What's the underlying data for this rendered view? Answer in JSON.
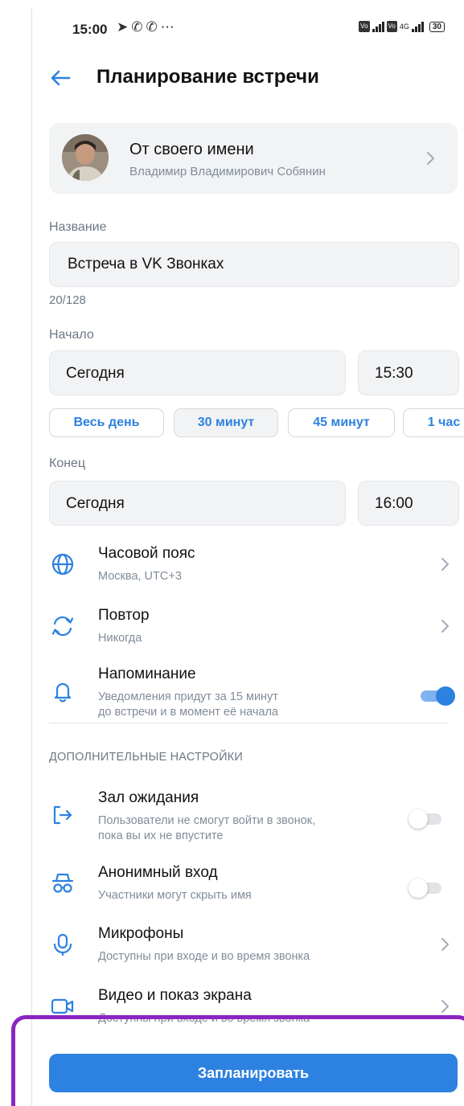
{
  "status_bar": {
    "time": "15:00",
    "left_icons": [
      "location-arrow-icon",
      "whatsapp-icon",
      "viber-icon",
      "more-dots-icon"
    ],
    "network_label": "4G",
    "battery": "30"
  },
  "header": {
    "title": "Планирование встречи"
  },
  "author": {
    "title": "От своего имени",
    "name": "Владимир Владимирович Собянин"
  },
  "name_field": {
    "label": "Название",
    "value": "Встреча в VK Звонках",
    "counter": "20/128"
  },
  "start": {
    "label": "Начало",
    "date": "Сегодня",
    "time": "15:30"
  },
  "duration_chips": [
    {
      "label": "Весь день",
      "selected": false
    },
    {
      "label": "30 минут",
      "selected": true
    },
    {
      "label": "45 минут",
      "selected": false
    },
    {
      "label": "1 час",
      "selected": false
    }
  ],
  "end": {
    "label": "Конец",
    "date": "Сегодня",
    "time": "16:00"
  },
  "settings": {
    "timezone": {
      "title": "Часовой пояс",
      "subtitle": "Москва, UTC+3"
    },
    "repeat": {
      "title": "Повтор",
      "subtitle": "Никогда"
    },
    "reminder": {
      "title": "Напоминание",
      "subtitle_line1": "Уведомления придут за 15 минут",
      "subtitle_line2": "до встречи и в момент её начала",
      "enabled": true
    }
  },
  "additional": {
    "header": "ДОПОЛНИТЕЛЬНЫЕ НАСТРОЙКИ",
    "waiting_room": {
      "title": "Зал ожидания",
      "subtitle_line1": "Пользователи не смогут войти в звонок,",
      "subtitle_line2": "пока вы их не впустите",
      "enabled": false
    },
    "anonymous": {
      "title": "Анонимный вход",
      "subtitle": "Участники могут скрыть имя",
      "enabled": false
    },
    "microphones": {
      "title": "Микрофоны",
      "subtitle": "Доступны при входе и во время звонка"
    },
    "video": {
      "title": "Видео и показ экрана",
      "subtitle": "Доступны при входе и во время звонка"
    }
  },
  "submit": {
    "label": "Запланировать"
  },
  "colors": {
    "accent": "#2d81e0",
    "highlight": "#8b25c2",
    "field_bg": "#f2f3f5",
    "secondary_text": "#818c99"
  }
}
